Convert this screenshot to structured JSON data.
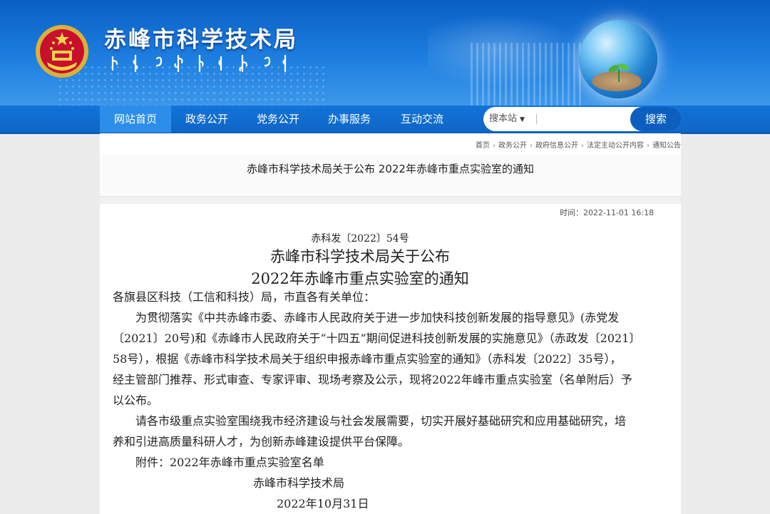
{
  "header": {
    "site_title": "赤峰市科学技术局"
  },
  "nav": {
    "items": [
      {
        "label": "网站首页"
      },
      {
        "label": "政务公开"
      },
      {
        "label": "党务公开"
      },
      {
        "label": "办事服务"
      },
      {
        "label": "互动交流"
      }
    ],
    "active_index": 0
  },
  "search": {
    "scope_label": "搜本站",
    "placeholder": "",
    "button_label": "搜索"
  },
  "breadcrumb": [
    "首页",
    "政务公开",
    "政府信息公开",
    "法定主动公开内容",
    "通知公告"
  ],
  "page_title": "赤峰市科学技术局关于公布 2022年赤峰市重点实验室的通知",
  "meta": {
    "time_label": "时间：2022-11-01 16:18"
  },
  "document": {
    "number": "赤科发〔2022〕54号",
    "heading_line1": "赤峰市科学技术局关于公布",
    "heading_line2": "2022年赤峰市重点实验室的通知",
    "lines": [
      "各旗县区科技（工信和科技）局，市直各有关单位：",
      "为贯彻落实《中共赤峰市委、赤峰市人民政府关于进一步加快科技创新发展的指导意见》(赤党发",
      "〔2021〕20号)和《赤峰市人民政府关于“十四五”期间促进科技创新发展的实施意见》（赤政发〔2021〕",
      "58号），根据《赤峰市科学技术局关于组织申报赤峰市重点实验室的通知》（赤科发〔2022〕35号），",
      "经主管部门推荐、形式审查、专家评审、现场考察及公示，现将2022年峰市重点实验室（名单附后）予",
      "以公布。",
      "请各市级重点实验室围绕我市经济建设与社会发展需要，切实开展好基础研究和应用基础研究，培",
      "养和引进高质量科研人才，为创新赤峰建设提供平台保障。",
      "附件：2022年赤峰市重点实验室名单",
      "赤峰市科学技术局",
      "2022年10月31日"
    ]
  },
  "colors": {
    "header_blue": "#0a5fc4",
    "nav_blue": "#1273d8",
    "nav_active": "#2c8eea",
    "search_button": "#0d5fbf"
  }
}
